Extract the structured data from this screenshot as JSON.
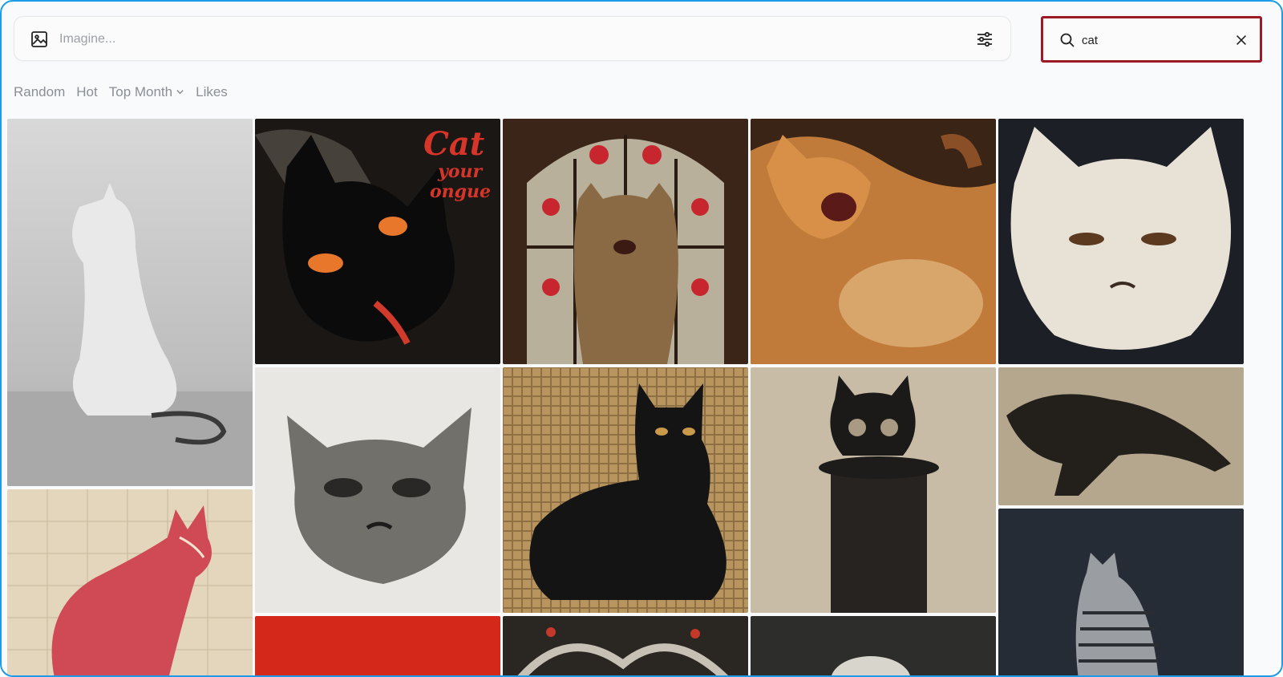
{
  "prompt": {
    "placeholder": "Imagine..."
  },
  "search": {
    "value": "cat"
  },
  "tabs": [
    {
      "label": "Random"
    },
    {
      "label": "Hot"
    },
    {
      "label": "Top Month",
      "has_dropdown": true
    },
    {
      "label": "Likes"
    }
  ],
  "icons": {
    "prompt": "image-icon",
    "settings": "sliders-icon",
    "search": "search-icon",
    "clear": "close-icon",
    "dropdown": "chevron-down-icon"
  },
  "colors": {
    "search_border": "#9c1a26",
    "frame_border": "#1e9be8"
  },
  "gallery": {
    "poster_text": [
      "Cat",
      "your",
      "ongue"
    ],
    "tiles": [
      {
        "name": "gallery-image-white-cat-sculpture"
      },
      {
        "name": "gallery-image-cat-your-tongue-poster"
      },
      {
        "name": "gallery-image-stained-glass-cat"
      },
      {
        "name": "gallery-image-yawning-orange-cat"
      },
      {
        "name": "gallery-image-grumpy-white-cat-painting"
      },
      {
        "name": "gallery-image-anatomy-cat"
      },
      {
        "name": "gallery-image-charcoal-cat-sketch"
      },
      {
        "name": "gallery-image-mosaic-black-cat"
      },
      {
        "name": "gallery-image-black-cat-on-pillar"
      },
      {
        "name": "gallery-image-prowling-cat-painting"
      },
      {
        "name": "gallery-image-striped-cat-dark"
      },
      {
        "name": "gallery-image-red-abstract"
      },
      {
        "name": "gallery-image-mosaic-pattern"
      },
      {
        "name": "gallery-image-white-cat-dark"
      }
    ]
  }
}
